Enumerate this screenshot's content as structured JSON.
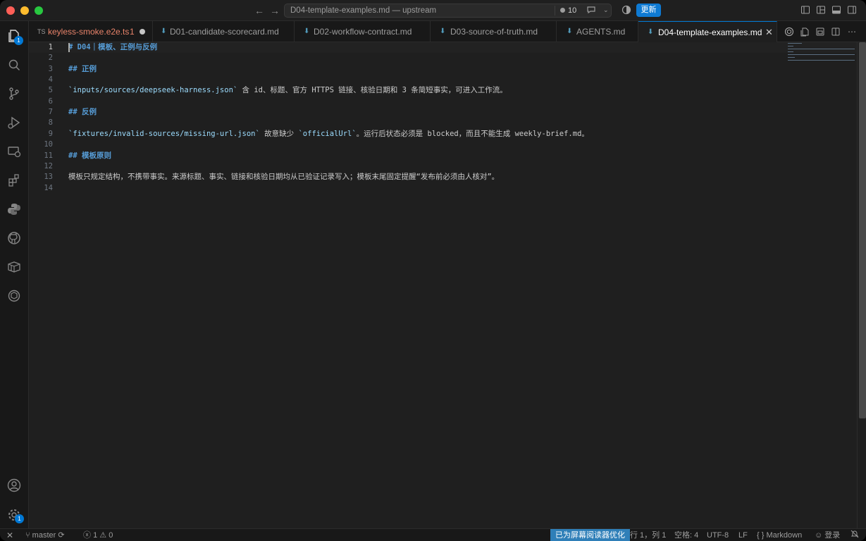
{
  "titlebar": {
    "title": "D04-template-examples.md — upstream",
    "badge_count": "10",
    "update_label": "更新"
  },
  "activity": {
    "explorer_badge": "1",
    "settings_badge": "1"
  },
  "tabs": [
    {
      "label": "keyless-smoke.e2e.ts",
      "icon": "TS",
      "problems": "1",
      "modified": true,
      "active": false
    },
    {
      "label": "D01-candidate-scorecard.md",
      "icon": "markdown-icon",
      "active": false
    },
    {
      "label": "D02-workflow-contract.md",
      "icon": "markdown-icon",
      "active": false
    },
    {
      "label": "D03-source-of-truth.md",
      "icon": "markdown-icon",
      "active": false
    },
    {
      "label": "AGENTS.md",
      "icon": "markdown-icon",
      "active": false
    },
    {
      "label": "D04-template-examples.md",
      "icon": "markdown-icon",
      "active": true
    }
  ],
  "editor": {
    "lines": [
      {
        "n": "1",
        "parts": [
          {
            "t": "# D04｜模板、正例与反例",
            "c": "h"
          }
        ]
      },
      {
        "n": "2",
        "parts": []
      },
      {
        "n": "3",
        "parts": [
          {
            "t": "## 正例",
            "c": "h"
          }
        ]
      },
      {
        "n": "4",
        "parts": []
      },
      {
        "n": "5",
        "parts": [
          {
            "t": "`inputs/sources/deepseek-harness.json`",
            "c": "ic2"
          },
          {
            "t": " 含 id、标题、官方 HTTPS 链接、核验日期和 3 条简短事实，可进入工作流。",
            "c": "txt"
          }
        ]
      },
      {
        "n": "6",
        "parts": []
      },
      {
        "n": "7",
        "parts": [
          {
            "t": "## 反例",
            "c": "h"
          }
        ]
      },
      {
        "n": "8",
        "parts": []
      },
      {
        "n": "9",
        "parts": [
          {
            "t": "`fixtures/invalid-sources/missing-url.json`",
            "c": "ic2"
          },
          {
            "t": " 故意缺少 ",
            "c": "txt"
          },
          {
            "t": "`officialUrl`",
            "c": "ic2"
          },
          {
            "t": "。运行后状态必须是 blocked，而且不能生成 weekly-brief.md。",
            "c": "txt"
          }
        ]
      },
      {
        "n": "10",
        "parts": []
      },
      {
        "n": "11",
        "parts": [
          {
            "t": "## 模板原则",
            "c": "h"
          }
        ]
      },
      {
        "n": "12",
        "parts": []
      },
      {
        "n": "13",
        "parts": [
          {
            "t": "模板只规定结构，不携带事实。来源标题、事实、链接和核验日期均从已验证记录写入；模板末尾固定提醒“发布前必须由人核对”。",
            "c": "txt"
          }
        ]
      },
      {
        "n": "14",
        "parts": []
      }
    ]
  },
  "statusbar": {
    "branch": "master",
    "errors": "1",
    "warnings": "0",
    "screen_reader": "已为屏幕阅读器优化",
    "position": "行 1，列 1",
    "spaces": "空格: 4",
    "encoding": "UTF-8",
    "eol": "LF",
    "language": "Markdown",
    "account": "登录"
  },
  "colors": {
    "accent": "#0078d4",
    "heading": "#569cd6",
    "inline_code": "#9cdcfe",
    "modified_tab": "#e8836a",
    "statusbar_accent": "#2f7fb8"
  }
}
